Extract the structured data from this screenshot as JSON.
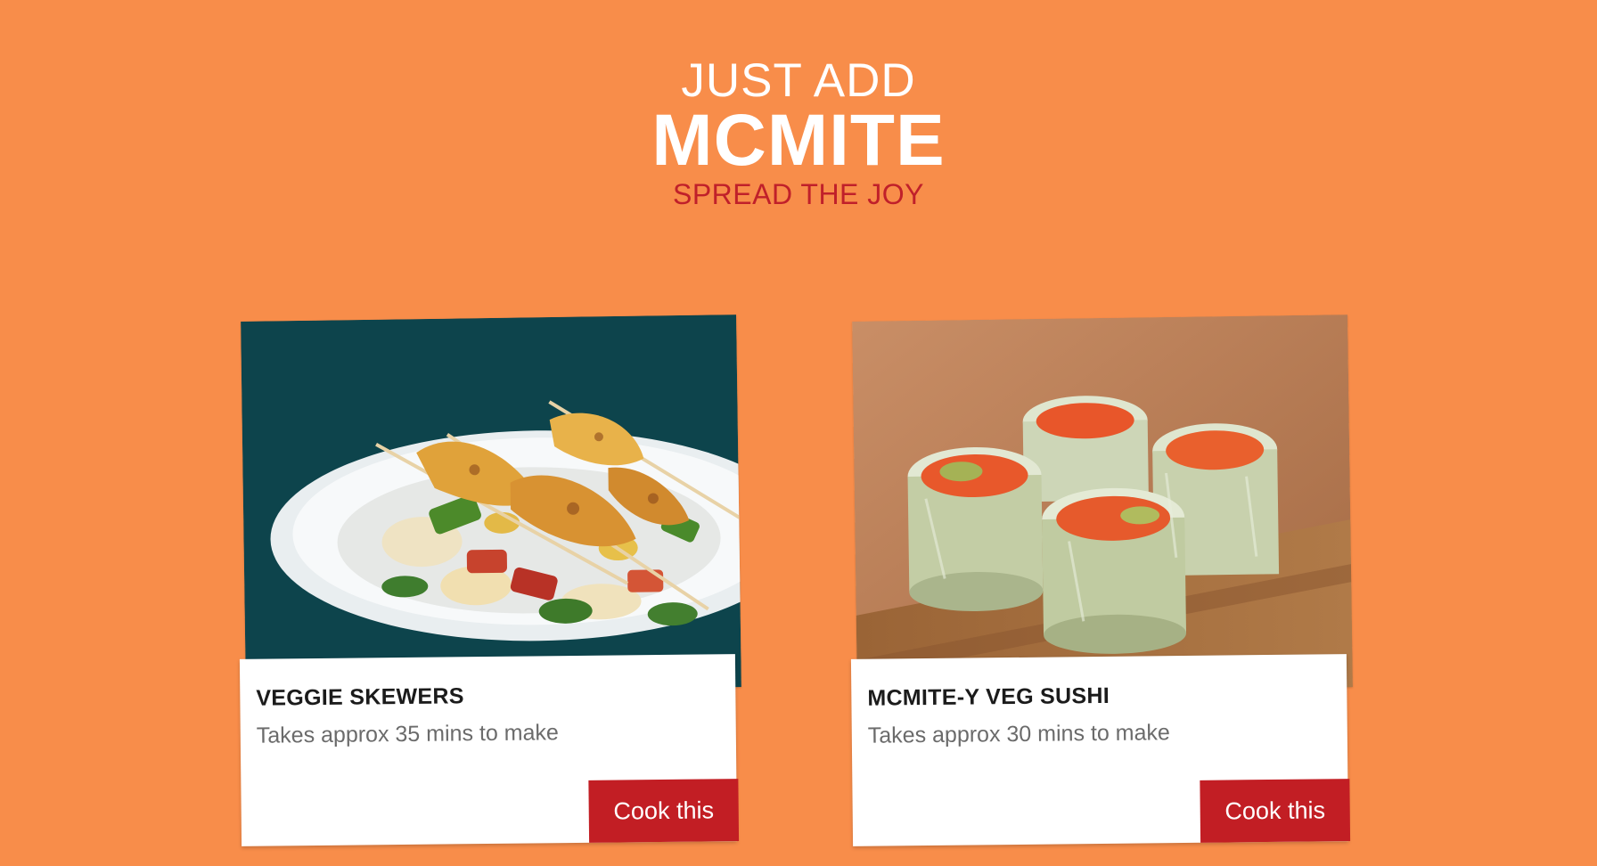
{
  "hero": {
    "kicker": "JUST ADD",
    "brand": "MCMITE",
    "tagline": "SPREAD THE JOY"
  },
  "colors": {
    "background": "#f88d4a",
    "accent": "#c21e24",
    "tagline": "#c0202a"
  },
  "recipes": [
    {
      "title": "VEGGIE SKEWERS",
      "meta": "Takes approx 35 mins to make",
      "cta": "Cook this",
      "image": "veggie-skewers-photo"
    },
    {
      "title": "MCMITE-Y VEG SUSHI",
      "meta": "Takes approx 30 mins to make",
      "cta": "Cook this",
      "image": "veg-sushi-photo"
    }
  ]
}
